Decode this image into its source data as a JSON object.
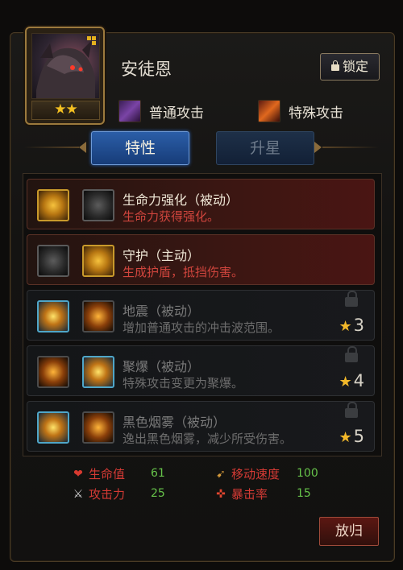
{
  "hero": {
    "name": "安徒恩",
    "stars": "★★"
  },
  "header": {
    "lock_label": "锁定"
  },
  "attacks": {
    "normal": "普通攻击",
    "special": "特殊攻击"
  },
  "tabs": {
    "traits": "特性",
    "star_up": "升星"
  },
  "skills": [
    {
      "title": "生命力强化（被动）",
      "desc": "生命力获得强化。",
      "state": "active",
      "icon1": "heart-aura-icon",
      "icon2": "blade-icon"
    },
    {
      "title": "守护（主动）",
      "desc": "生成护盾，抵挡伤害。",
      "state": "active",
      "icon1": "spike-burst-icon",
      "icon2": "shield-bell-icon"
    },
    {
      "title": "地震（被动）",
      "desc": "增加普通攻击的冲击波范围。",
      "state": "locked",
      "requirement": "3",
      "icon1": "quake-burst-icon",
      "icon2": "flame-claw-icon"
    },
    {
      "title": "聚爆（被动）",
      "desc": "特殊攻击变更为聚爆。",
      "state": "locked",
      "requirement": "4",
      "icon1": "fire-pillar-icon",
      "icon2": "flame-column-icon"
    },
    {
      "title": "黑色烟雾（被动）",
      "desc": "逸出黑色烟雾，减少所受伤害。",
      "state": "locked",
      "requirement": "5",
      "icon1": "claw-heart-icon",
      "icon2": "fireball-icon"
    }
  ],
  "stats": {
    "hp_label": "生命值",
    "hp_value": "61",
    "atk_label": "攻击力",
    "atk_value": "25",
    "speed_label": "移动速度",
    "speed_value": "100",
    "crit_label": "暴击率",
    "crit_value": "15"
  },
  "footer": {
    "return_label": "放归"
  },
  "colors": {
    "accent_gold": "#c99a2b",
    "tab_active": "#2b5ea8",
    "desc_red": "#d0453d",
    "stat_green": "#66c34a"
  }
}
